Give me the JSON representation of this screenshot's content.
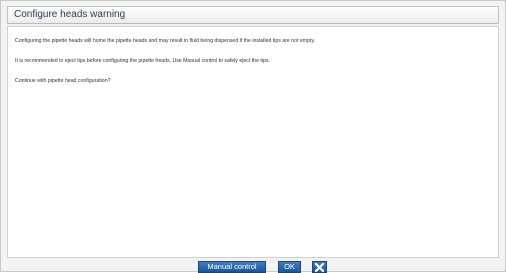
{
  "dialog": {
    "title": "Configure heads warning",
    "messages": [
      "Configuring the pipette heads will home the pipette heads and may result in fluid being dispensed if the installed tips are not empty.",
      "It is recommended to eject tips before configuring the pipette heads. Use Manual control to safely eject the tips.",
      "Continue with pipette head configuration?"
    ],
    "buttons": {
      "manual_control": "Manual control",
      "ok": "OK",
      "close_icon": "close-icon"
    },
    "colors": {
      "button_blue": "#1c5596",
      "title_text": "#2f3b52"
    }
  }
}
